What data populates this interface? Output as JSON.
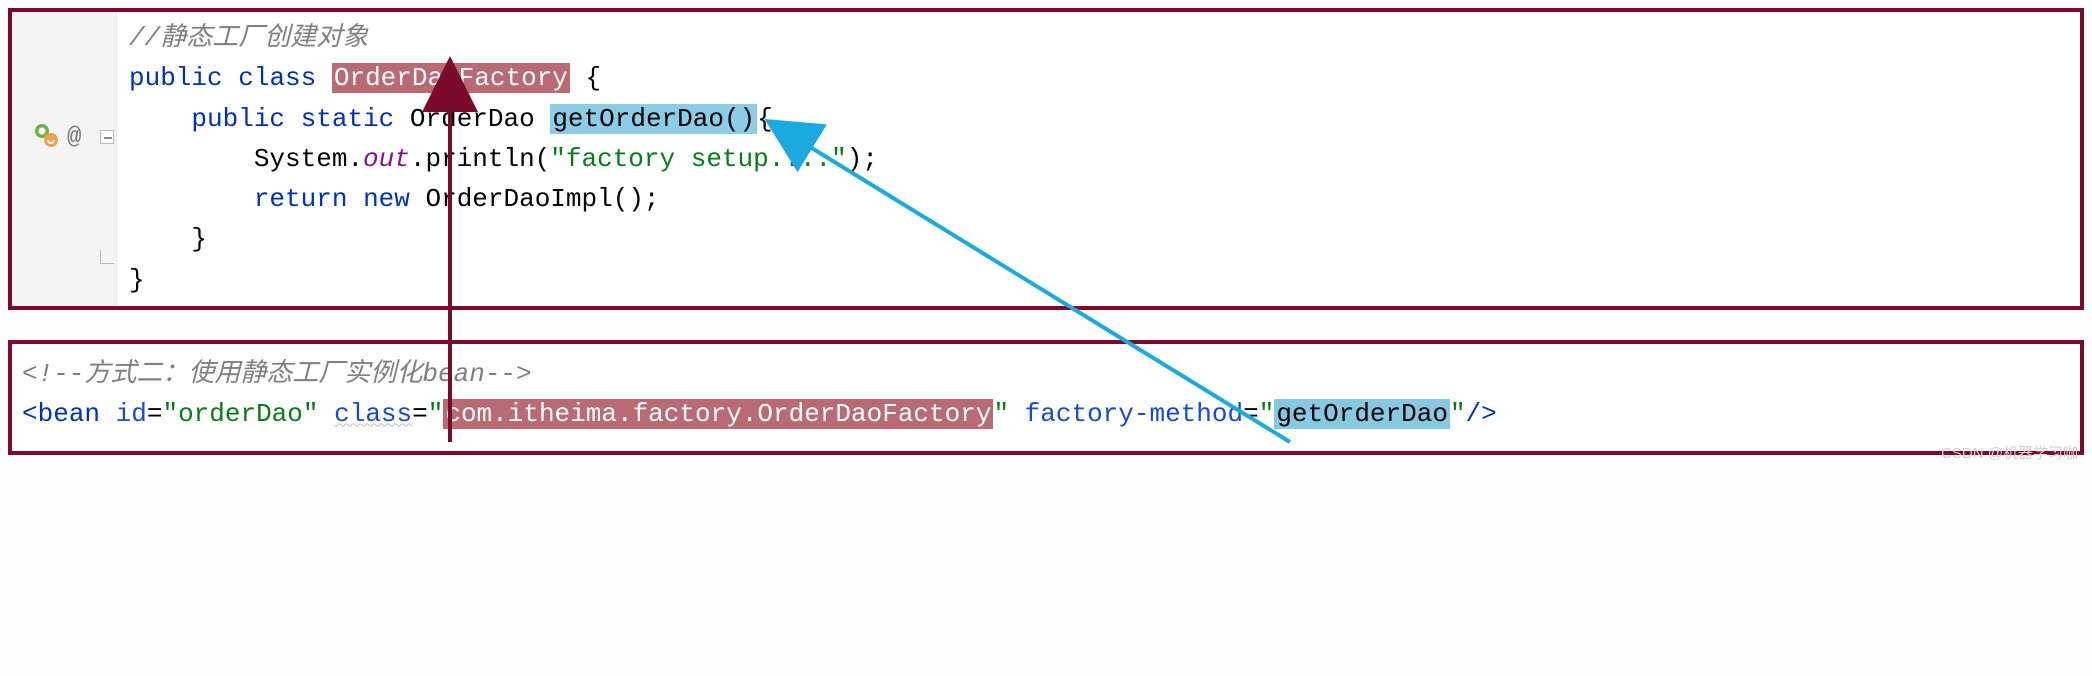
{
  "code": {
    "comment": "//静态工厂创建对象",
    "kw_public": "public",
    "kw_class": "class",
    "class_name": "OrderDaoFactory",
    "brace_open": " {",
    "kw_static": "static",
    "ret_type": "OrderDao",
    "method_name": "getOrderDao()",
    "method_brace": "{",
    "stmt_system": "System.",
    "stmt_out": "out",
    "stmt_println": ".println(",
    "stmt_string": "\"factory setup....\"",
    "stmt_end": ");",
    "kw_return": "return",
    "kw_new": "new",
    "impl": "OrderDaoImpl();",
    "brace_close1": "}",
    "brace_close2": "}",
    "gutter_at": "@"
  },
  "xml": {
    "comment": "<!--方式二：使用静态工厂实例化bean-->",
    "tag_open": "<",
    "tag_name": "bean",
    "attr_id": "id",
    "val_id": "\"orderDao\"",
    "attr_class": "class",
    "val_class_q1": "\"",
    "val_class_body": "com.itheima.factory.OrderDaoFactory",
    "val_class_q2": "\"",
    "attr_fm": "factory-method",
    "val_fm_q1": "\"",
    "val_fm_body": "getOrderDao",
    "val_fm_q2": "\"",
    "tag_close": "/>",
    "eq": "="
  },
  "watermark": "CSDN @机器学习咖"
}
